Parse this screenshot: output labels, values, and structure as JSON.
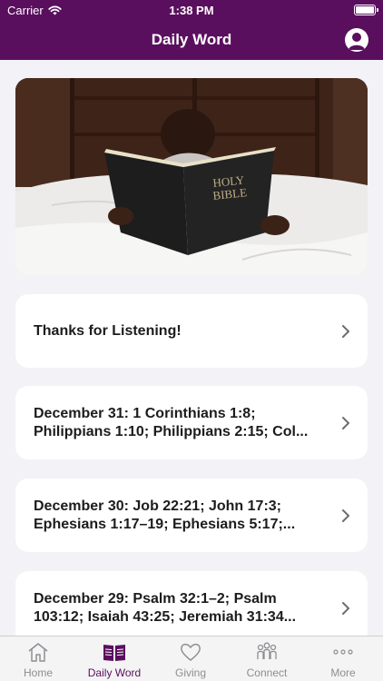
{
  "status_bar": {
    "carrier": "Carrier",
    "time": "1:38 PM"
  },
  "nav": {
    "title": "Daily Word"
  },
  "items": [
    {
      "title": "Thanks for Listening!"
    },
    {
      "title": "December 31: 1 Corinthians 1:8; Philippians 1:10; Philippians 2:15; Col..."
    },
    {
      "title": "December 30: Job 22:21; John 17:3; Ephesians 1:17–19; Ephesians 5:17;..."
    },
    {
      "title": "December 29: Psalm 32:1–2; Psalm 103:12; Isaiah 43:25; Jeremiah 31:34..."
    }
  ],
  "tabs": [
    {
      "label": "Home",
      "icon": "home-icon"
    },
    {
      "label": "Daily Word",
      "icon": "bible-icon",
      "active": true
    },
    {
      "label": "Giving",
      "icon": "heart-icon"
    },
    {
      "label": "Connect",
      "icon": "people-icon"
    },
    {
      "label": "More",
      "icon": "more-icon"
    }
  ],
  "colors": {
    "brand": "#5a0f5e",
    "inactive": "#8e8e93",
    "background": "#f2f2f7"
  }
}
